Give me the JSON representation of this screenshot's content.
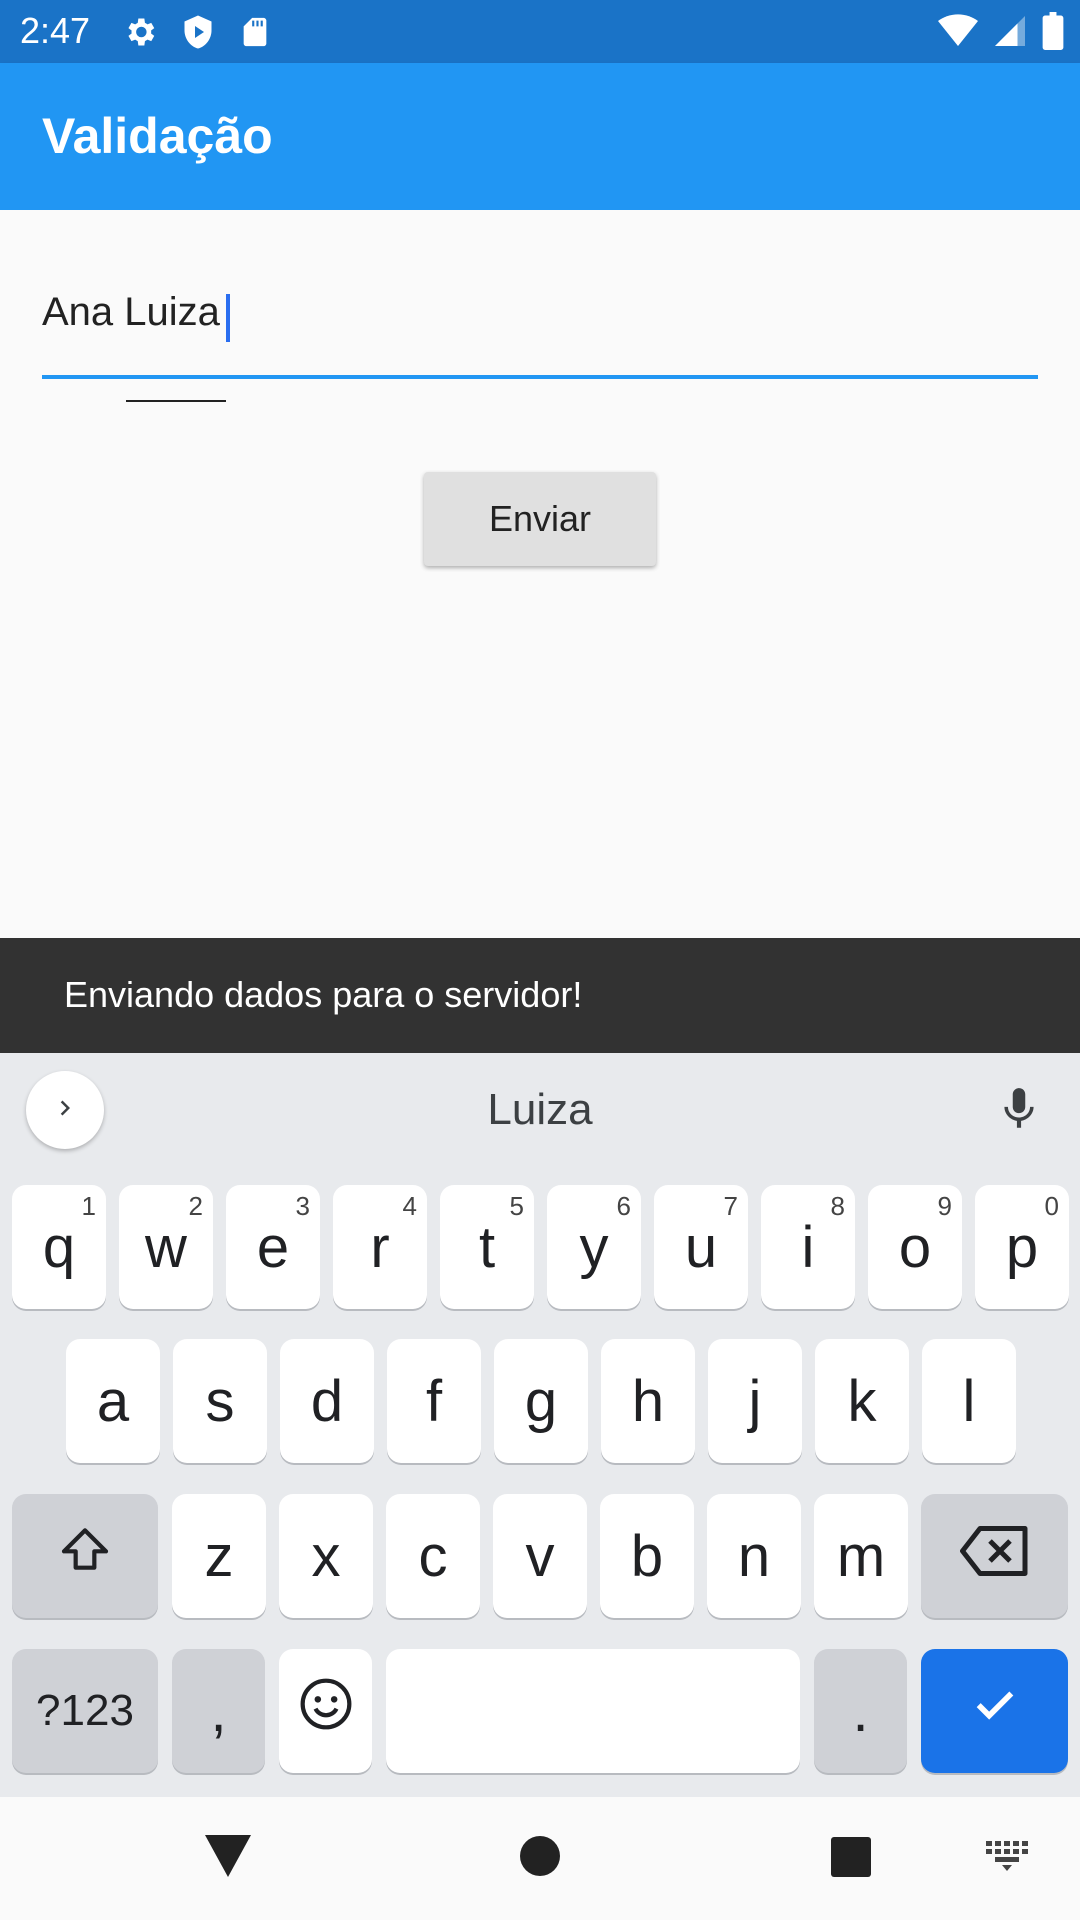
{
  "status_bar": {
    "time": "2:47"
  },
  "app_bar": {
    "title": "Validação"
  },
  "form": {
    "name_value": "Ana Luiza",
    "send_label": "Enviar"
  },
  "snackbar": {
    "message": "Enviando dados para o servidor!"
  },
  "keyboard": {
    "suggestion": "Luiza",
    "row1": [
      {
        "key": "q",
        "hint": "1"
      },
      {
        "key": "w",
        "hint": "2"
      },
      {
        "key": "e",
        "hint": "3"
      },
      {
        "key": "r",
        "hint": "4"
      },
      {
        "key": "t",
        "hint": "5"
      },
      {
        "key": "y",
        "hint": "6"
      },
      {
        "key": "u",
        "hint": "7"
      },
      {
        "key": "i",
        "hint": "8"
      },
      {
        "key": "o",
        "hint": "9"
      },
      {
        "key": "p",
        "hint": "0"
      }
    ],
    "row2": [
      "a",
      "s",
      "d",
      "f",
      "g",
      "h",
      "j",
      "k",
      "l"
    ],
    "row3": [
      "z",
      "x",
      "c",
      "v",
      "b",
      "n",
      "m"
    ],
    "symbols_label": "?123",
    "comma_label": ",",
    "period_label": ".",
    "accent_color": "#1a73e8"
  },
  "icons": {
    "status": [
      "gear-icon",
      "shield-play-icon",
      "sd-card-icon",
      "wifi-icon",
      "signal-icon",
      "battery-icon"
    ],
    "keyboard": [
      "chevron-right-icon",
      "mic-icon",
      "shift-icon",
      "backspace-icon",
      "emoji-icon",
      "check-icon"
    ],
    "nav": [
      "back-icon",
      "home-icon",
      "recents-icon",
      "keyboard-switch-icon"
    ]
  }
}
